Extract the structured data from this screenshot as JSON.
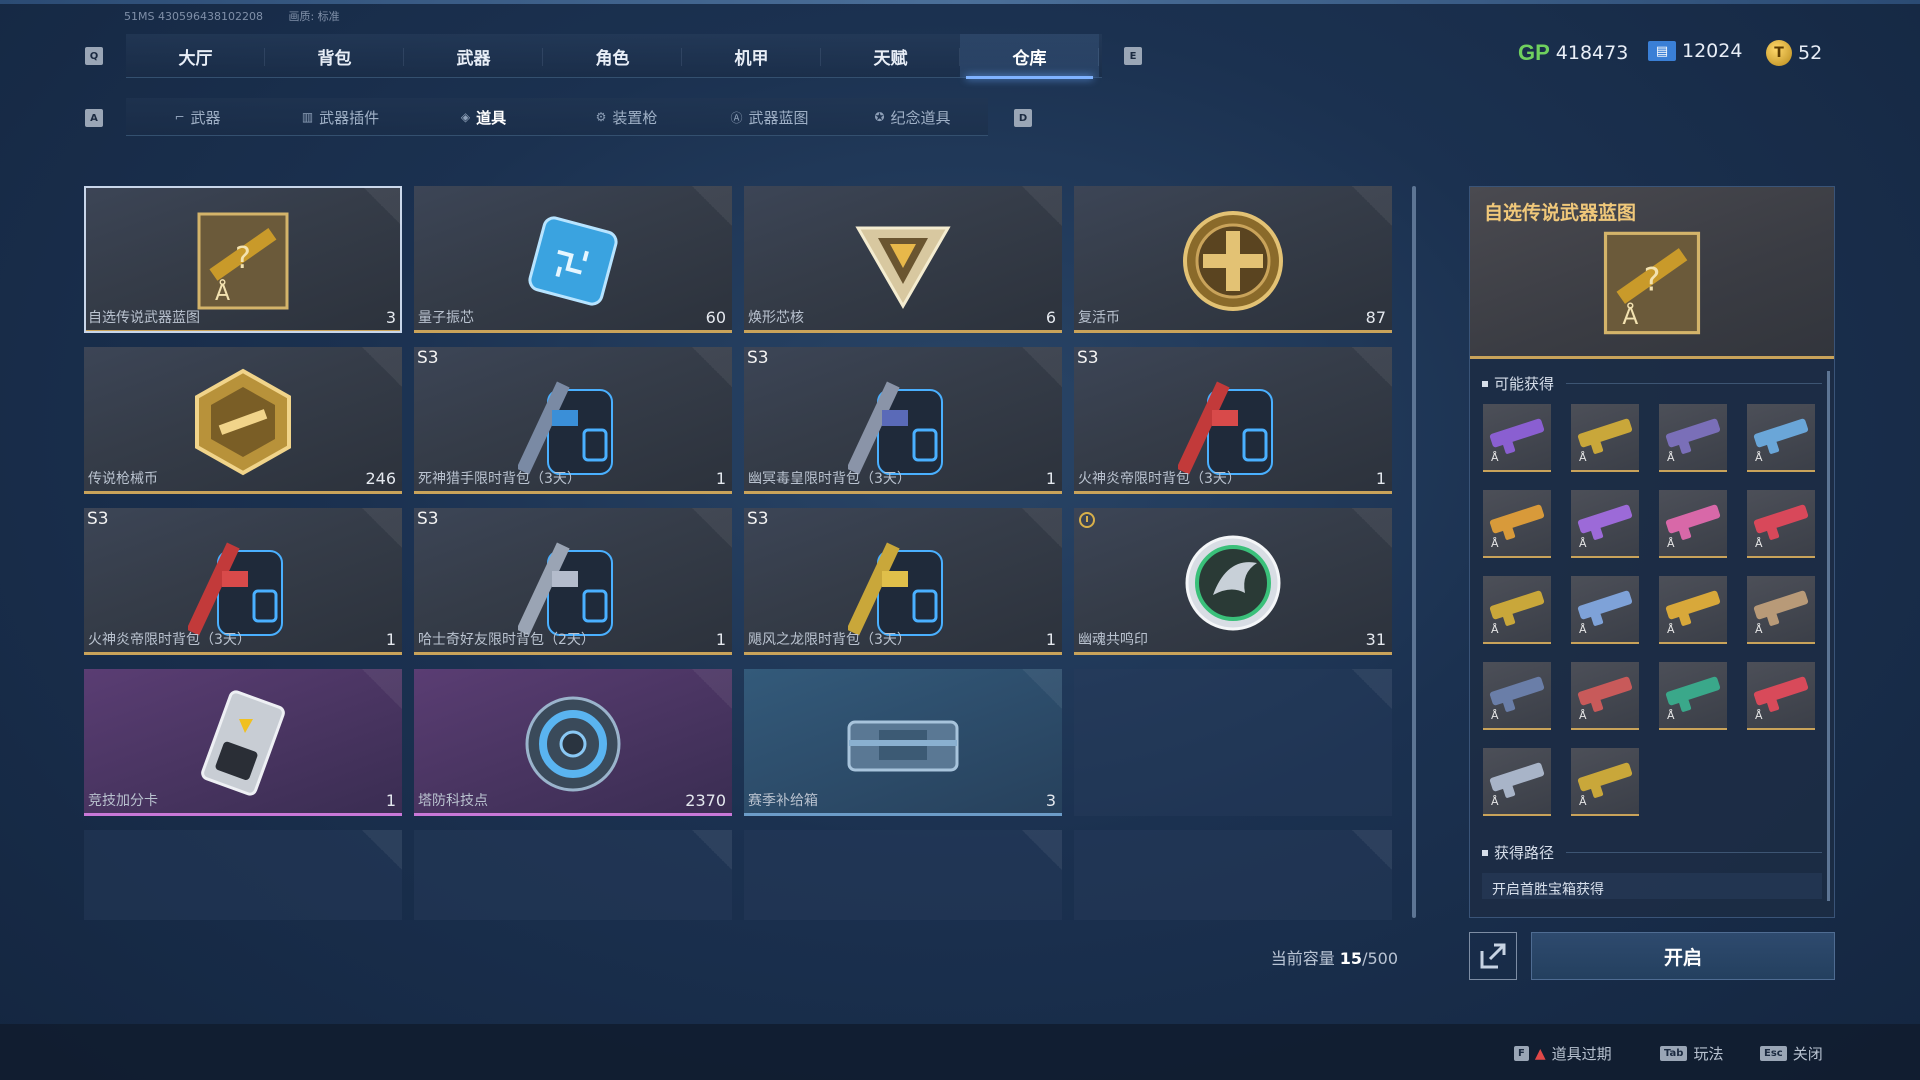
{
  "meta": {
    "uid": "51MS 430596438102208",
    "quality": "画质: 标准"
  },
  "keys": {
    "prev_tab": "Q",
    "next_tab": "E",
    "prev_sub": "A",
    "next_sub": "D"
  },
  "top_tabs": [
    {
      "label": "大厅"
    },
    {
      "label": "背包"
    },
    {
      "label": "武器"
    },
    {
      "label": "角色"
    },
    {
      "label": "机甲"
    },
    {
      "label": "天赋"
    },
    {
      "label": "仓库",
      "active": true
    }
  ],
  "currency": {
    "gp_label": "GP",
    "gp": "418473",
    "tickets": "12024",
    "coins": "52"
  },
  "sub_tabs": [
    {
      "label": "武器"
    },
    {
      "label": "武器插件"
    },
    {
      "label": "道具",
      "active": true
    },
    {
      "label": "装置枪"
    },
    {
      "label": "武器蓝图"
    },
    {
      "label": "纪念道具"
    }
  ],
  "items": [
    {
      "name": "自选传说武器蓝图",
      "qty": "3",
      "icon": "legendary-blueprint-icon"
    },
    {
      "name": "量子振芯",
      "qty": "60",
      "icon": "quantum-chip-icon"
    },
    {
      "name": "焕形芯核",
      "qty": "6",
      "icon": "reshape-core-icon"
    },
    {
      "name": "复活币",
      "qty": "87",
      "icon": "revive-coin-icon"
    },
    {
      "name": "传说枪械币",
      "qty": "246",
      "icon": "legendary-gun-coin-icon"
    },
    {
      "name": "死神猎手限时背包（3天）",
      "qty": "1",
      "season": "S3",
      "icon": "backpack-icon"
    },
    {
      "name": "幽冥毒皇限时背包（3天）",
      "qty": "1",
      "season": "S3",
      "icon": "backpack-icon"
    },
    {
      "name": "火神炎帝限时背包（3天）",
      "qty": "1",
      "season": "S3",
      "icon": "backpack-icon"
    },
    {
      "name": "火神炎帝限时背包（3天）",
      "qty": "1",
      "season": "S3",
      "icon": "backpack-icon"
    },
    {
      "name": "哈士奇好友限时背包（2天）",
      "qty": "1",
      "season": "S3",
      "icon": "backpack-icon"
    },
    {
      "name": "飓风之龙限时背包（3天）",
      "qty": "1",
      "season": "S3",
      "icon": "backpack-icon"
    },
    {
      "name": "幽魂共鸣印",
      "qty": "31",
      "icon": "ghost-resonance-seal-icon"
    },
    {
      "name": "竞技加分卡",
      "qty": "1",
      "icon": "ranked-bonus-card-icon"
    },
    {
      "name": "塔防科技点",
      "qty": "2370",
      "icon": "tower-defense-tech-icon"
    },
    {
      "name": "赛季补给箱",
      "qty": "3",
      "icon": "season-supply-box-icon"
    }
  ],
  "capacity": {
    "label": "当前容量",
    "used": "15",
    "total": "/500"
  },
  "panel": {
    "title": "自选传说武器蓝图",
    "possible_label": "可能获得",
    "route_label": "获得路径",
    "route_text": "开启首胜宝箱获得",
    "rewards": [
      "#8a5fd1",
      "#c9a73a",
      "#7a6fb8",
      "#6aa6d8",
      "#d89a3a",
      "#9c6ad8",
      "#d868a8",
      "#d8485a",
      "#c9a73a",
      "#7ea2d8",
      "#d8a83a",
      "#b89a78",
      "#6a7ea8",
      "#c85a5a",
      "#3aa88a",
      "#d84a5a",
      "#a8b4c8",
      "#c9a73a"
    ]
  },
  "actions": {
    "open": "开启"
  },
  "footer": {
    "expired": "道具过期",
    "play": "玩法",
    "close": "关闭",
    "key_f": "F",
    "key_tab": "Tab",
    "key_esc": "Esc"
  }
}
